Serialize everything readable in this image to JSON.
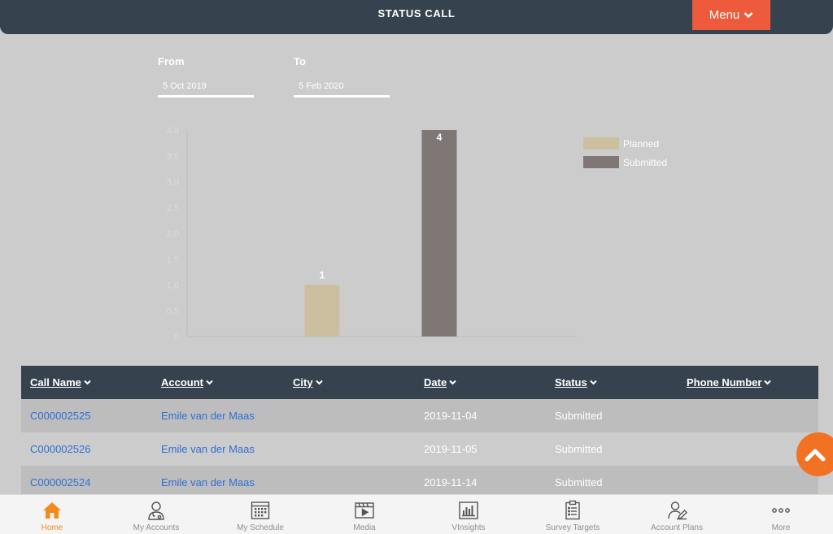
{
  "header": {
    "title": "STATUS CALL",
    "menu_label": "Menu"
  },
  "filters": {
    "from_label": "From",
    "from_value": "5 Oct 2019",
    "to_label": "To",
    "to_value": "5 Feb 2020"
  },
  "chart_data": {
    "type": "bar",
    "categories": [
      "Planned",
      "Submitted"
    ],
    "values": [
      1,
      4
    ],
    "data_labels": [
      "1",
      "4"
    ],
    "y_ticks": [
      "0",
      "0.5",
      "1.0",
      "1.5",
      "2.0",
      "2.5",
      "3.0",
      "3.5",
      "4.0"
    ],
    "ylim": [
      0,
      4
    ],
    "legend": [
      "Planned",
      "Submitted"
    ],
    "legend_placement": "top-right",
    "colors": [
      "#cbbf9f",
      "#7f7676"
    ],
    "grid": false
  },
  "table": {
    "columns": [
      "Call Name",
      "Account",
      "City",
      "Date",
      "Status",
      "Phone Number"
    ],
    "rows": [
      {
        "call_name": "C000002525",
        "account": "Emile van der Maas",
        "city": "",
        "date": "2019-11-04",
        "status": "Submitted",
        "phone": ""
      },
      {
        "call_name": "C000002526",
        "account": "Emile van der Maas",
        "city": "",
        "date": "2019-11-05",
        "status": "Submitted",
        "phone": ""
      },
      {
        "call_name": "C000002524",
        "account": "Emile van der Maas",
        "city": "",
        "date": "2019-11-14",
        "status": "Submitted",
        "phone": ""
      }
    ]
  },
  "tabbar": {
    "items": [
      {
        "label": "Home",
        "icon": "home-icon",
        "active": true
      },
      {
        "label": "My Accounts",
        "icon": "doctor-icon",
        "active": false
      },
      {
        "label": "My Schedule",
        "icon": "calendar-icon",
        "active": false
      },
      {
        "label": "Media",
        "icon": "media-icon",
        "active": false
      },
      {
        "label": "VInsights",
        "icon": "chart-icon",
        "active": false
      },
      {
        "label": "Survey Targets",
        "icon": "clipboard-icon",
        "active": false
      },
      {
        "label": "Account Plans",
        "icon": "account-plan-icon",
        "active": false
      },
      {
        "label": "More",
        "icon": "more-icon",
        "active": false
      }
    ]
  },
  "colors": {
    "header": "#36434f",
    "menu": "#ee5a3c",
    "fab": "#f27224",
    "active_tab": "#f28a1e",
    "link": "#2f6fd6"
  }
}
